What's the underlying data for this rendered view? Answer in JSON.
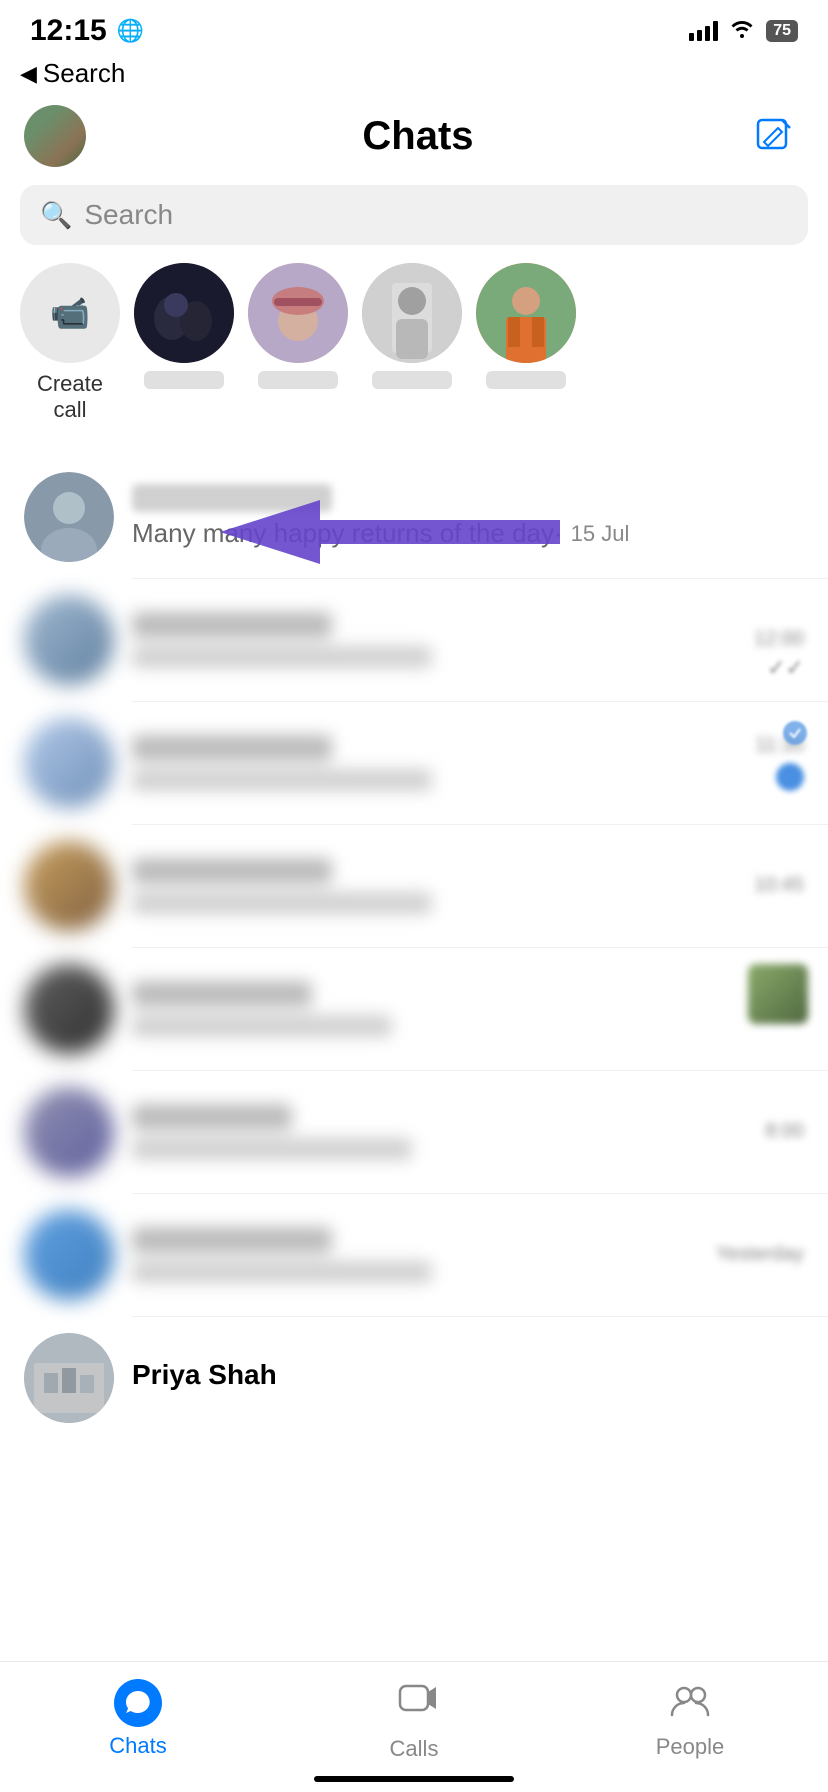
{
  "status": {
    "time": "12:15",
    "globe": "🌐",
    "battery": "75"
  },
  "nav": {
    "back_label": "Search"
  },
  "header": {
    "title": "Chats",
    "compose_tooltip": "Compose"
  },
  "search": {
    "placeholder": "Search"
  },
  "stories": {
    "create_label_line1": "Create",
    "create_label_line2": "call",
    "items": [
      {
        "id": "story1",
        "color": "dark"
      },
      {
        "id": "story2",
        "color": "pink"
      },
      {
        "id": "story3",
        "color": "bw"
      },
      {
        "id": "story4",
        "color": "orange"
      }
    ]
  },
  "chats": {
    "featured_item": {
      "message": "Many many happy returns of the day·",
      "time": "15 Jul"
    },
    "blurred_items": [
      {
        "id": "chat2",
        "has_badge": false,
        "color": "#a0b8d0",
        "ticks": "✓✓"
      },
      {
        "id": "chat3",
        "has_badge": true,
        "color": "#b0c8e0"
      },
      {
        "id": "chat4",
        "has_badge": false,
        "color": "#c8a060"
      },
      {
        "id": "chat5",
        "has_badge": false,
        "color": "#606060"
      },
      {
        "id": "chat6",
        "has_badge": false,
        "color": "#9090a0"
      }
    ],
    "last_item": {
      "name": "Priya Shah",
      "color": "#b0b8c0"
    }
  },
  "bottom_nav": {
    "chats_label": "Chats",
    "calls_label": "Calls",
    "people_label": "People"
  }
}
